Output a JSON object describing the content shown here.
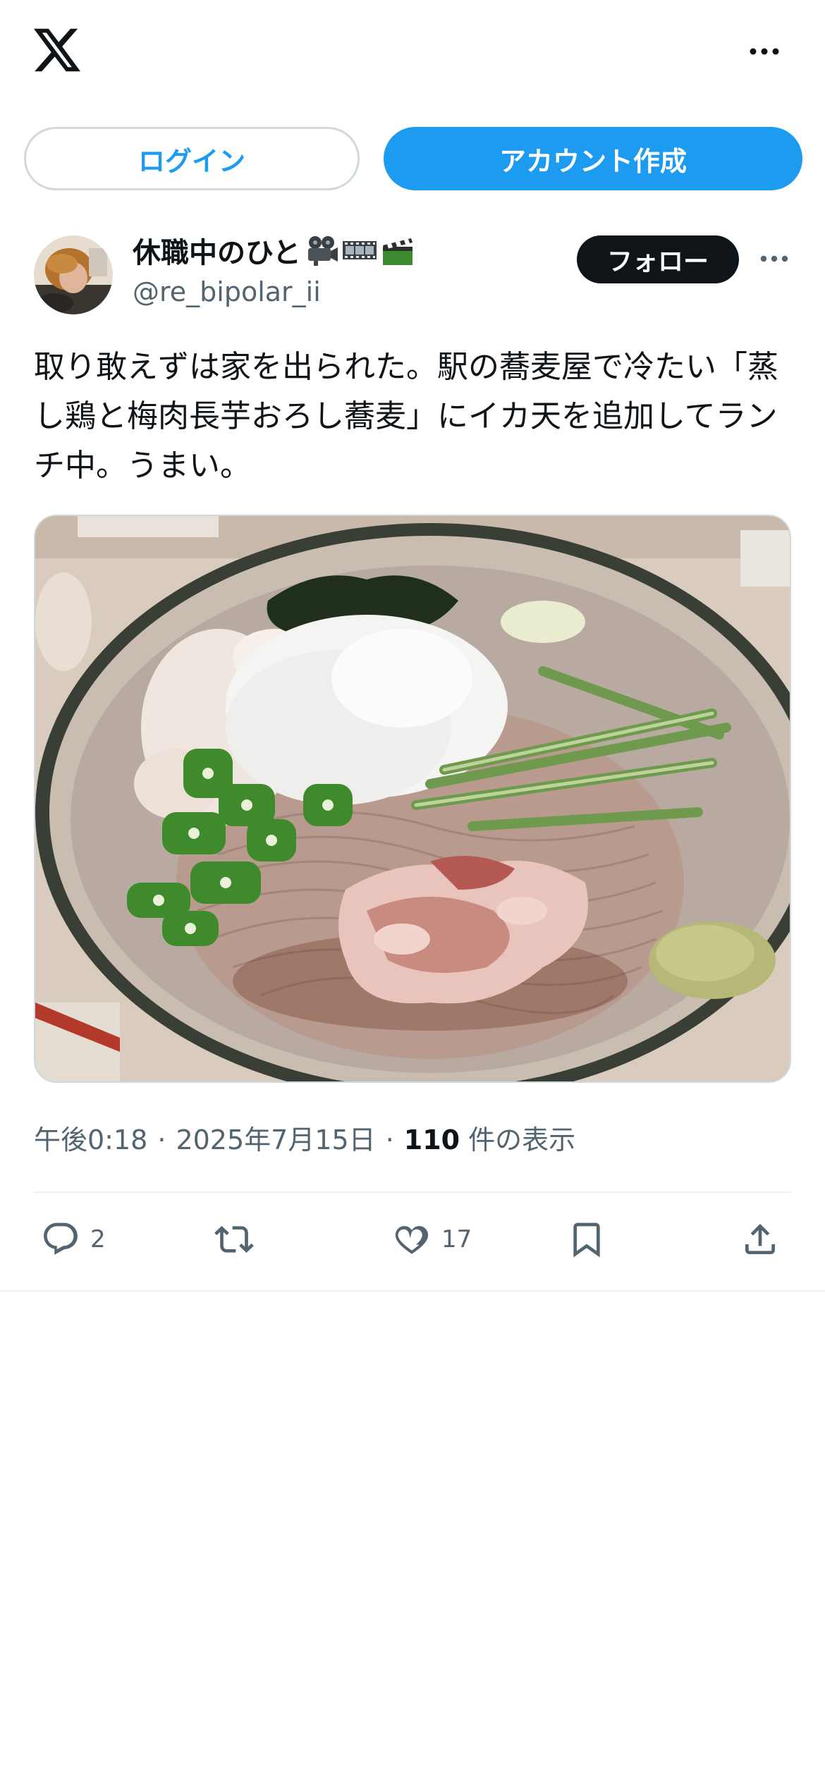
{
  "header": {
    "logo_icon": "x-logo-icon",
    "more_icon": "more-horizontal-icon"
  },
  "auth": {
    "login_label": "ログイン",
    "signup_label": "アカウント作成"
  },
  "tweet": {
    "author": {
      "display_name": "休職中のひと",
      "name_emojis": [
        "movie-camera-icon",
        "film-frames-icon",
        "clapper-board-icon"
      ],
      "handle": "@re_bipolar_ii",
      "avatar_icon": "avatar-photo"
    },
    "follow_label": "フォロー",
    "text": "取り敢えずは家を出られた。駅の蕎麦屋で冷たい「蒸し鶏と梅肉長芋おろし蕎麦」にイカ天を追加してランチ中。うまい。",
    "media_alt": "food-photo",
    "time": "午後0:18",
    "separator": "·",
    "date": "2025年7月15日",
    "views_count": "110",
    "views_label": "件の表示",
    "actions": {
      "reply_count": "2",
      "retweet_count": "",
      "like_count": "17"
    }
  },
  "colors": {
    "accent": "#1d9bf0",
    "text": "#0f1419",
    "secondary": "#536471",
    "border": "#cfd9de"
  }
}
